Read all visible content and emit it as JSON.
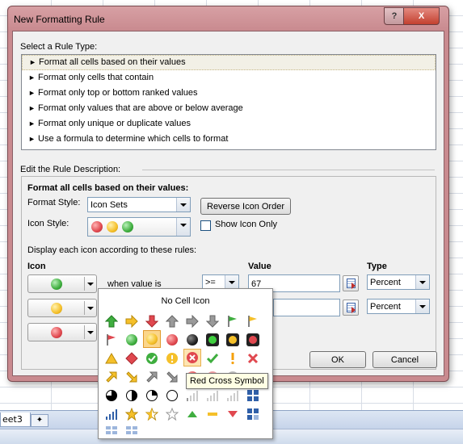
{
  "dialog": {
    "title": "New Formatting Rule",
    "help_label": "?",
    "close_label": "X"
  },
  "sheet": {
    "tab_label": "eet3"
  },
  "rule_type": {
    "heading": "Select a Rule Type:",
    "items": [
      "Format all cells based on their values",
      "Format only cells that contain",
      "Format only top or bottom ranked values",
      "Format only values that are above or below average",
      "Format only unique or duplicate values",
      "Use a formula to determine which cells to format"
    ],
    "selected_index": 0
  },
  "description": {
    "heading": "Edit the Rule Description:",
    "subheading": "Format all cells based on their values:",
    "format_style_label": "Format Style:",
    "format_style_value": "Icon Sets",
    "reverse_button": "Reverse Icon Order",
    "icon_style_label": "Icon Style:",
    "show_icon_only_label": "Show Icon Only",
    "rules_label": "Display each icon according to these rules:",
    "col_icon": "Icon",
    "col_value": "Value",
    "col_type": "Type",
    "rows": [
      {
        "icon_color": "#3fae3f",
        "condition": "when value is",
        "operator": ">=",
        "value": "67",
        "type": "Percent"
      },
      {
        "icon_color": "#f5c02a",
        "condition": "",
        "operator": "",
        "value": "",
        "type": "Percent"
      },
      {
        "icon_color": "#e0484f",
        "condition": "",
        "operator": "",
        "value": "",
        "type": ""
      }
    ]
  },
  "buttons": {
    "ok": "OK",
    "cancel": "Cancel"
  },
  "icon_picker": {
    "header": "No Cell Icon",
    "tooltip": "Red Cross Symbol"
  },
  "colors": {
    "green": "#3fae3f",
    "yellow": "#f5c02a",
    "red": "#e0484f",
    "highlight": "#fbd68b",
    "dialog_frame": "#c98a8f"
  }
}
